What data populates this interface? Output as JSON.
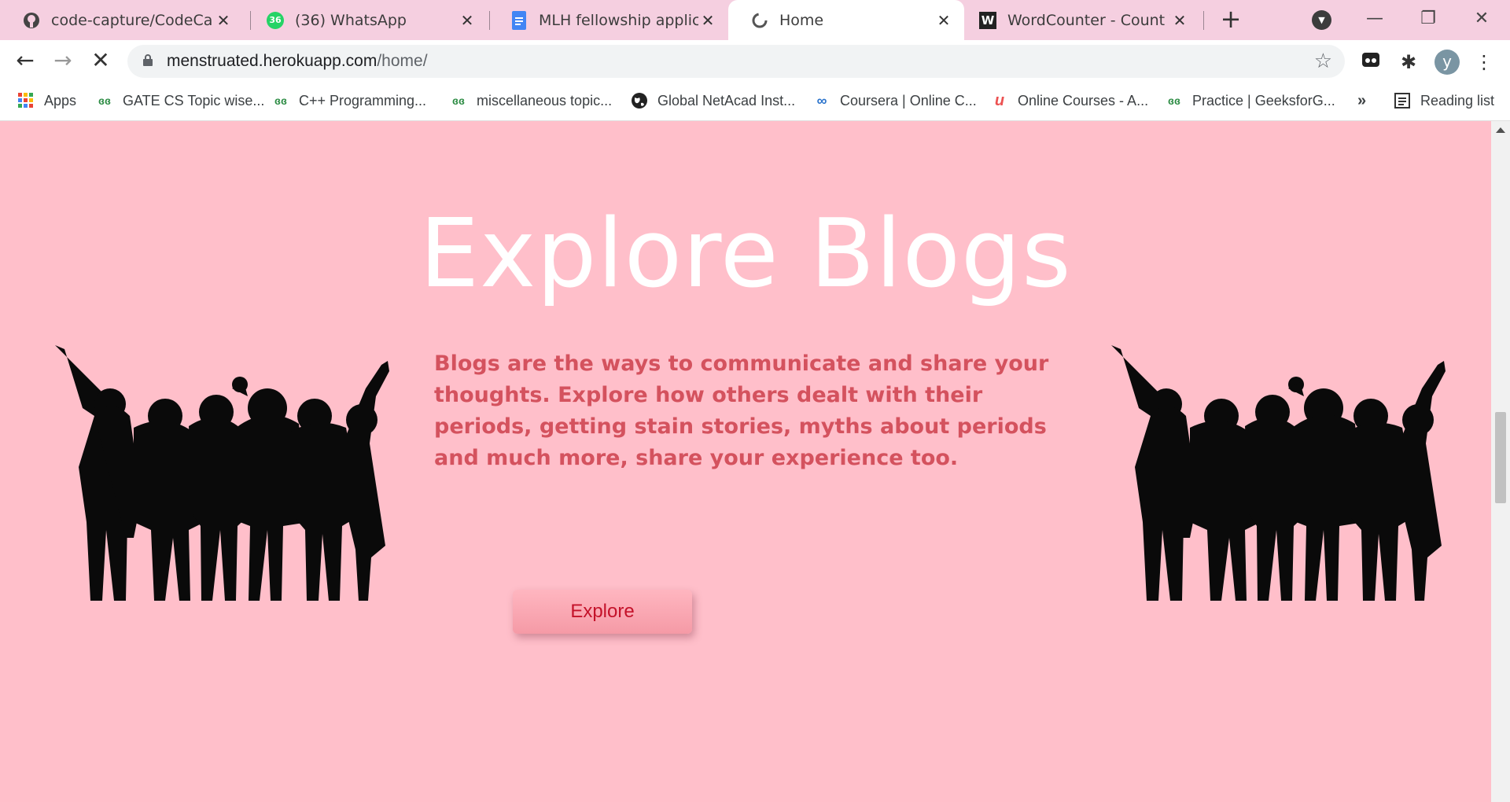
{
  "tabs": [
    {
      "title": "code-capture/CodeCaptur",
      "icon": "github-icon"
    },
    {
      "title": "(36) WhatsApp",
      "icon": "whatsapp-icon",
      "badge": "36"
    },
    {
      "title": "MLH fellowship applicatio",
      "icon": "google-docs-icon"
    },
    {
      "title": "Home",
      "icon": "page-loading-icon"
    },
    {
      "title": "WordCounter - Count Wo",
      "icon": "wordcounter-icon",
      "badge": "W"
    }
  ],
  "address": {
    "host": "menstruated.herokuapp.com",
    "path": "/home/"
  },
  "profile_initial": "y",
  "bookmarks": [
    {
      "label": "Apps",
      "icon": "apps-grid-icon"
    },
    {
      "label": "GATE CS Topic wise...",
      "icon": "geeksforgeeks-icon"
    },
    {
      "label": "C++ Programming...",
      "icon": "geeksforgeeks-icon"
    },
    {
      "label": "miscellaneous topic...",
      "icon": "geeksforgeeks-icon"
    },
    {
      "label": "Global NetAcad Inst...",
      "icon": "globe-icon"
    },
    {
      "label": "Coursera | Online C...",
      "icon": "coursera-icon"
    },
    {
      "label": "Online Courses - A...",
      "icon": "udemy-icon"
    },
    {
      "label": "Practice | GeeksforG...",
      "icon": "geeksforgeeks-icon"
    }
  ],
  "bookmarks_more": "»",
  "reading_list": "Reading list",
  "page": {
    "heading": "Explore Blogs",
    "description": "Blogs are the ways to communicate and share your thoughts. Explore how others dealt with their periods, getting stain stories, myths about periods and much more, share your experience too.",
    "button_label": "Explore"
  },
  "colors": {
    "page_bg": "#ffbfca",
    "heading": "#ffffff",
    "description": "#d4525e",
    "button_text": "#c4122a"
  }
}
